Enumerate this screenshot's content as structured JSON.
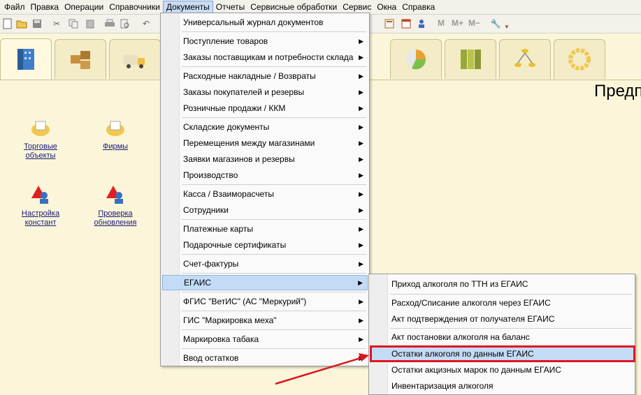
{
  "menubar": {
    "items": [
      "Файл",
      "Правка",
      "Операции",
      "Справочники",
      "Документы",
      "Отчеты",
      "Сервисные обработки",
      "Сервис",
      "Окна",
      "Справка"
    ]
  },
  "toolbar": {
    "m_label": "M",
    "m_plus_label": "M+",
    "m_minus_label": "M−"
  },
  "page": {
    "title": "Предп"
  },
  "shortcuts": [
    {
      "label": "Торговые\nобъекты"
    },
    {
      "label": "Фирмы"
    },
    {
      "label": "Настройка\nконстант"
    },
    {
      "label": "Проверка\nобновления"
    }
  ],
  "documents_menu": {
    "items": [
      "Универсальный журнал документов",
      "Поступление товаров",
      "Заказы поставщикам и потребности склада",
      "Расходные накладные / Возвраты",
      "Заказы покупателей и резервы",
      "Розничные продажи / ККМ",
      "Складские документы",
      "Перемещения между магазинами",
      "Заявки магазинов и резервы",
      "Производство",
      "Касса / Взаиморасчеты",
      "Сотрудники",
      "Платежные карты",
      "Подарочные сертификаты",
      "Счет-фактуры",
      "ЕГАИС",
      "ФГИС \"ВетИС\" (АС \"Меркурий\")",
      "ГИС \"Маркировка меха\"",
      "Маркировка табака",
      "Ввод остатков"
    ]
  },
  "egais_menu": {
    "items": [
      "Приход алкоголя по ТТН из ЕГАИС",
      "Расход/Списание алкоголя через ЕГАИС",
      "Акт подтверждения от получателя ЕГАИС",
      "Акт постановки алкоголя на баланс",
      "Остатки алкоголя по данным ЕГАИС",
      "Остатки акцизных марок по данным ЕГАИС",
      "Инвентаризация алкоголя"
    ]
  },
  "colors": {
    "highlight_box": "#e0141e",
    "pointer_arrow": "#e0141e",
    "menu_highlight": "#c4dbf5"
  }
}
